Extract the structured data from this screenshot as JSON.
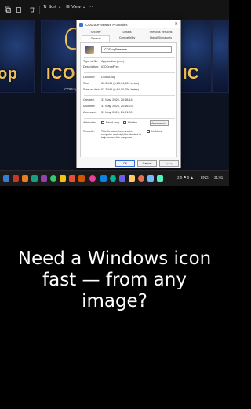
{
  "toolbar": {
    "sort_label": "Sort",
    "view_label": "View",
    "more_label": "···"
  },
  "gallery": {
    "thumb_left_text": "op",
    "thumb_center_text": "ICO",
    "thumb_center_caption": "ICODropFreeware.exe",
    "thumb_right_text": "IC"
  },
  "dialog": {
    "title": "ICODropFreeware Properties",
    "close_glyph": "✕",
    "tabs_row1": [
      "Security",
      "Details",
      "Previous Versions"
    ],
    "tabs_row2": [
      "General",
      "Compatibility",
      "Digital Signatures"
    ],
    "file_name": "ICODropFree.exe",
    "properties": [
      {
        "label": "Type of file:",
        "value": "Application (.exe)"
      },
      {
        "label": "Description:",
        "value": "ICODropFree"
      },
      {
        "label": "Location:",
        "value": "D:\\IcoDrop"
      },
      {
        "label": "Size:",
        "value": "63.3 MB (6,63,94,620 bytes)"
      },
      {
        "label": "Size on disk:",
        "value": "63.3 MB (6,64,00,256 bytes)"
      },
      {
        "label": "Created:",
        "value": "31 May, 2026, 20:58:14"
      },
      {
        "label": "Modified:",
        "value": "31 May, 2026, 20:56:23"
      },
      {
        "label": "Accessed:",
        "value": "31 May, 2026, 21:01:00"
      }
    ],
    "attributes_label": "Attributes:",
    "readonly_label": "Read-only",
    "hidden_label": "Hidden",
    "advanced_label": "Advanced...",
    "security_label": "Security:",
    "security_text": "This file came from another computer and might be blocked to help protect this computer.",
    "unblock_label": "Unblock",
    "ok_label": "OK",
    "cancel_label": "Cancel",
    "apply_label": "Apply"
  },
  "taskbar": {
    "tray_lang": "ENG",
    "tray_time": "21:01",
    "tray_small": "2:0 ⚑ 0 ▲"
  },
  "caption": {
    "text": "Need a Windows icon fast — from any image?"
  },
  "colors": {
    "accent": "#3a6fd8",
    "gold": "#f3c25c",
    "navy": "#132247"
  }
}
